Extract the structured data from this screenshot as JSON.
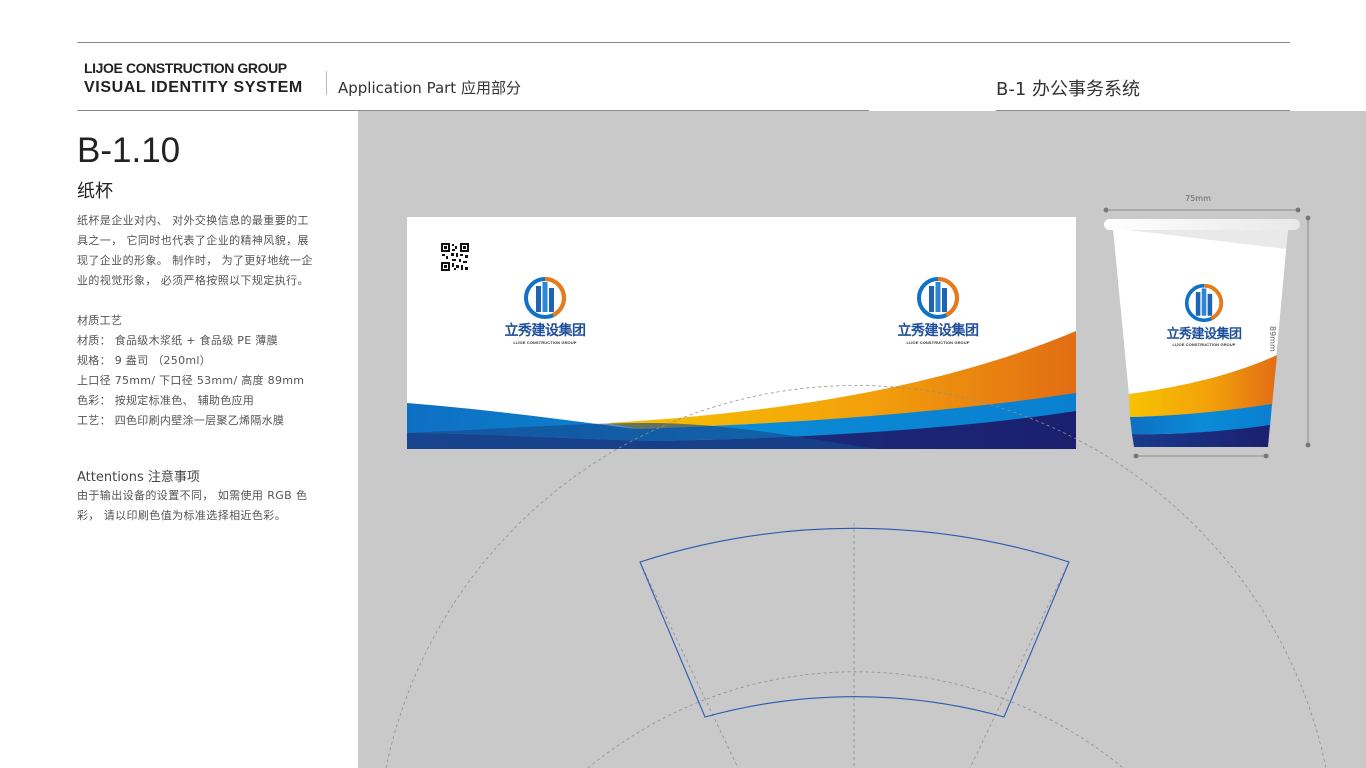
{
  "header": {
    "brand_line1": "LIJOE CONSTRUCTION GROUP",
    "brand_line2": "VISUAL IDENTITY SYSTEM",
    "section": "Application Part 应用部分",
    "page_code": "B-1 办公事务系统"
  },
  "item": {
    "code": "B-1.10",
    "title": "纸杯",
    "description": "纸杯是企业对内、 对外交换信息的最重要的工具之一， 它同时也代表了企业的精神风貌，展现了企业的形象。 制作时， 为了更好地统一企业的视觉形象， 必须严格按照以下规定执行。",
    "specs": [
      "材质工艺",
      "材质： 食品级木浆纸 + 食品级 PE 薄膜",
      "规格： 9 盎司 （250ml）",
      "上口径 75mm/ 下口径 53mm/ 高度 89mm",
      "色彩： 按规定标准色、 辅助色应用",
      "工艺： 四色印刷内壁涂一层聚乙烯隔水膜"
    ],
    "attention_title": "Attentions 注意事项",
    "attention_text": "由于输出设备的设置不同， 如需使用 RGB 色彩， 请以印刷色值为标准选择相近色彩。"
  },
  "logo": {
    "name_cn": "立秀建设集团",
    "name_en": "LIJOE CONSTRUCTION GROUP"
  },
  "dimensions": {
    "top_width": "75mm",
    "height": "89mm"
  },
  "colors": {
    "brand_blue": "#0f7fcf",
    "deep_navy": "#1b1f6e",
    "orange": "#e8781a",
    "yellow": "#f6c300",
    "panel_gray": "#c9c9c9"
  },
  "icons": [
    "qr-code-icon",
    "building-logo-icon"
  ]
}
